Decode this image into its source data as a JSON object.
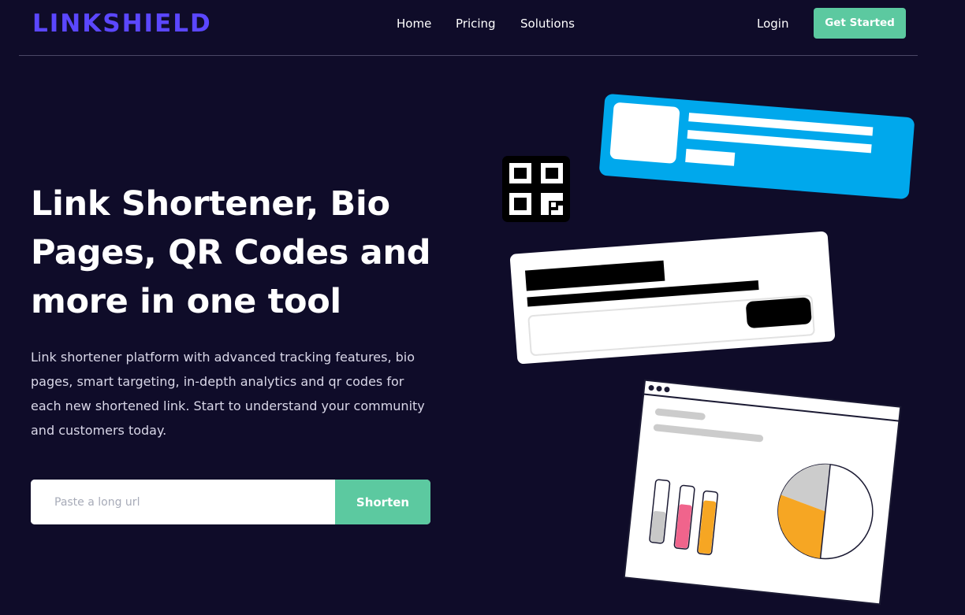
{
  "brand": {
    "logo_text": "LINKSHIELD",
    "accent_color": "#5b47ff",
    "cta_color": "#5cc9a0",
    "background_color": "#0f0c29"
  },
  "nav": {
    "items": [
      {
        "label": "Home"
      },
      {
        "label": "Pricing"
      },
      {
        "label": "Solutions"
      }
    ],
    "login_label": "Login",
    "cta_label": "Get Started"
  },
  "hero": {
    "title": "Link Shortener, Bio Pages, QR Codes and more in one tool",
    "description": "Link shortener platform with advanced tracking features, bio pages, smart targeting, in-depth analytics and qr codes for each new shortened link. Start to understand your community and customers today.",
    "input_placeholder": "Paste a long url",
    "input_value": "",
    "button_label": "Shorten"
  },
  "illustration": {
    "icons": [
      "qr-code-icon",
      "profile-card-icon",
      "form-card-icon",
      "analytics-window-icon",
      "pie-chart-icon",
      "bar-gauge-icon"
    ],
    "colors": {
      "profile_card": "#00a8ec",
      "pie_orange": "#f6a623",
      "pie_grey": "#cccccc",
      "gauge_pink": "#f0648c",
      "gauge_orange": "#f6a623",
      "gauge_grey": "#c8c8c8"
    }
  }
}
